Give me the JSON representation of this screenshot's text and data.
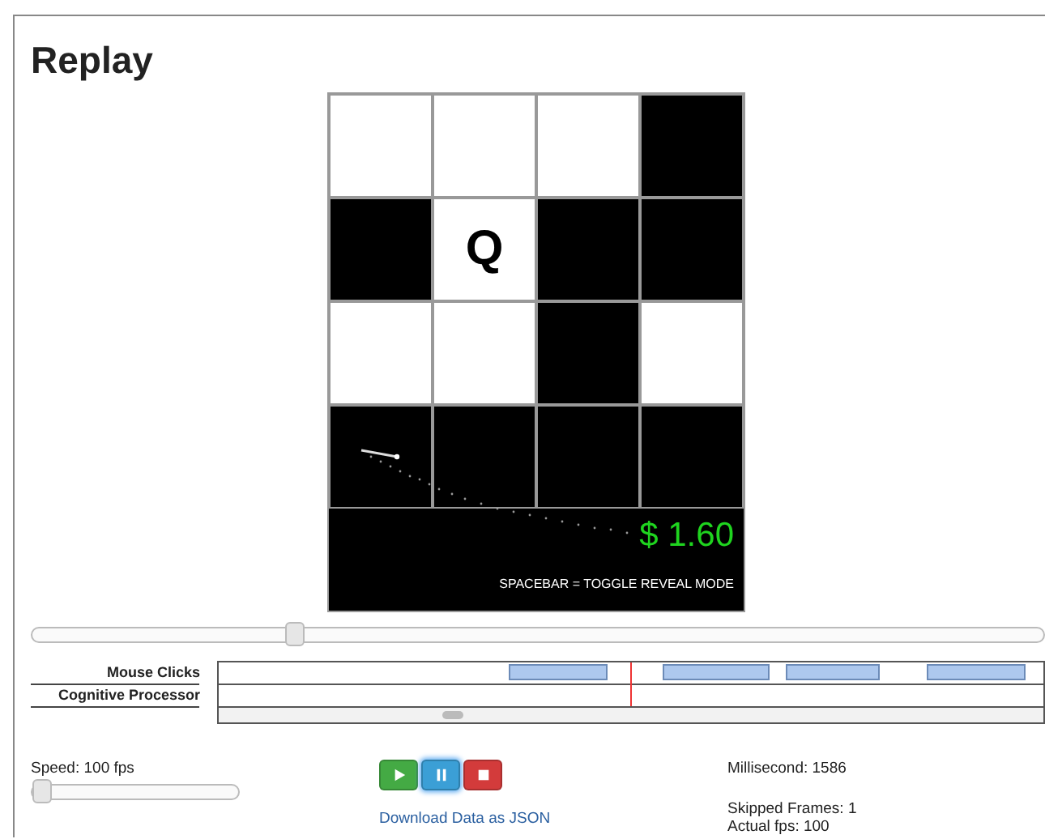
{
  "title": "Replay",
  "board": {
    "rows": [
      [
        {
          "filled": false
        },
        {
          "filled": false
        },
        {
          "filled": false
        },
        {
          "filled": true
        }
      ],
      [
        {
          "filled": true
        },
        {
          "filled": false,
          "letter": "Q"
        },
        {
          "filled": true
        },
        {
          "filled": true
        }
      ],
      [
        {
          "filled": false
        },
        {
          "filled": false
        },
        {
          "filled": true
        },
        {
          "filled": false
        }
      ],
      [
        {
          "filled": true
        },
        {
          "filled": true
        },
        {
          "filled": true
        },
        {
          "filled": true
        }
      ]
    ],
    "score": "$ 1.60",
    "hint": "SPACEBAR = TOGGLE REVEAL MODE"
  },
  "scrubber": {
    "level": 0.26
  },
  "timeline": {
    "tracks": [
      "Mouse Clicks",
      "Cognitive Processor"
    ]
  },
  "speed": {
    "label": "Speed: 100 fps",
    "level": 0
  },
  "controls": [
    {
      "kind": "play",
      "selected": false
    },
    {
      "kind": "pause",
      "selected": true
    },
    {
      "kind": "stop",
      "selected": false
    }
  ],
  "download_link": "Download Data as JSON",
  "stats": [
    "Millisecond: 1586",
    "Skipped Frames: 1",
    "Actual fps: 100"
  ]
}
